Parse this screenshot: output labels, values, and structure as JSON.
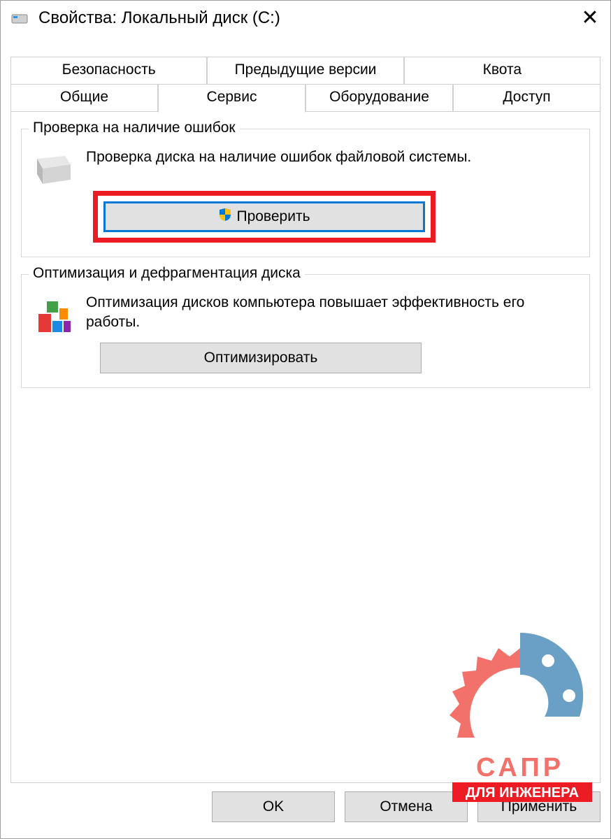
{
  "title": "Свойства: Локальный диск (C:)",
  "tabs": {
    "row1": [
      "Безопасность",
      "Предыдущие версии",
      "Квота"
    ],
    "row2": [
      "Общие",
      "Сервис",
      "Оборудование",
      "Доступ"
    ],
    "active": "Сервис"
  },
  "section_error_check": {
    "legend": "Проверка на наличие ошибок",
    "text": "Проверка диска на наличие ошибок файловой системы.",
    "button": "Проверить"
  },
  "section_optimize": {
    "legend": "Оптимизация и дефрагментация диска",
    "text": "Оптимизация дисков компьютера повышает эффективность его работы.",
    "button": "Оптимизировать"
  },
  "footer": {
    "ok": "OK",
    "cancel": "Отмена",
    "apply": "Применить"
  },
  "watermark": {
    "line1": "САПР",
    "line2": "ДЛЯ ИНЖЕНЕРА"
  }
}
